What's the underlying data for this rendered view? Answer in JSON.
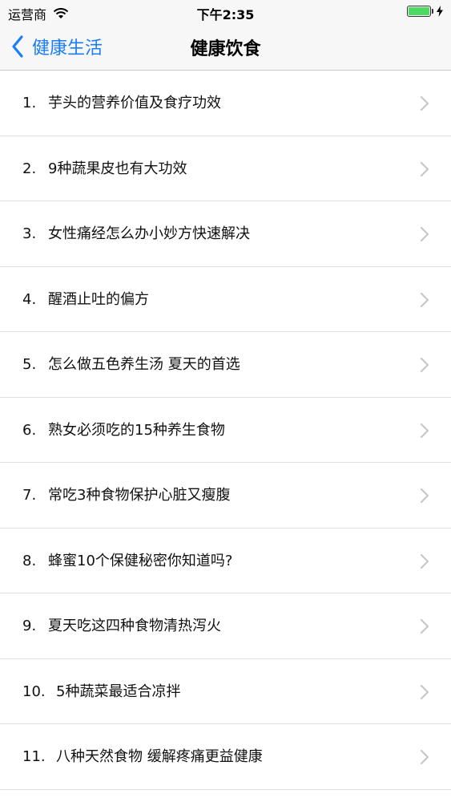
{
  "status_bar": {
    "carrier": "运营商",
    "time": "下午2:35",
    "battery_level": 1.0
  },
  "nav": {
    "back_label": "健康生活",
    "title": "健康饮食"
  },
  "items": [
    {
      "num": "1.",
      "title": "芋头的营养价值及食疗功效"
    },
    {
      "num": "2.",
      "title": "9种蔬果皮也有大功效"
    },
    {
      "num": "3.",
      "title": "女性痛经怎么办小妙方快速解决"
    },
    {
      "num": "4.",
      "title": "醒酒止吐的偏方"
    },
    {
      "num": "5.",
      "title": "怎么做五色养生汤 夏天的首选"
    },
    {
      "num": "6.",
      "title": "熟女必须吃的15种养生食物"
    },
    {
      "num": "7.",
      "title": "常吃3种食物保护心脏又瘦腹"
    },
    {
      "num": "8.",
      "title": "蜂蜜10个保健秘密你知道吗?"
    },
    {
      "num": "9.",
      "title": "夏天吃这四种食物清热泻火"
    },
    {
      "num": "10.",
      "title": "5种蔬菜最适合凉拌"
    },
    {
      "num": "11.",
      "title": "八种天然食物 缓解疼痛更益健康"
    }
  ],
  "colors": {
    "accent": "#1a7df3",
    "battery": "#4cd964",
    "chevron": "#c7c7cc"
  }
}
